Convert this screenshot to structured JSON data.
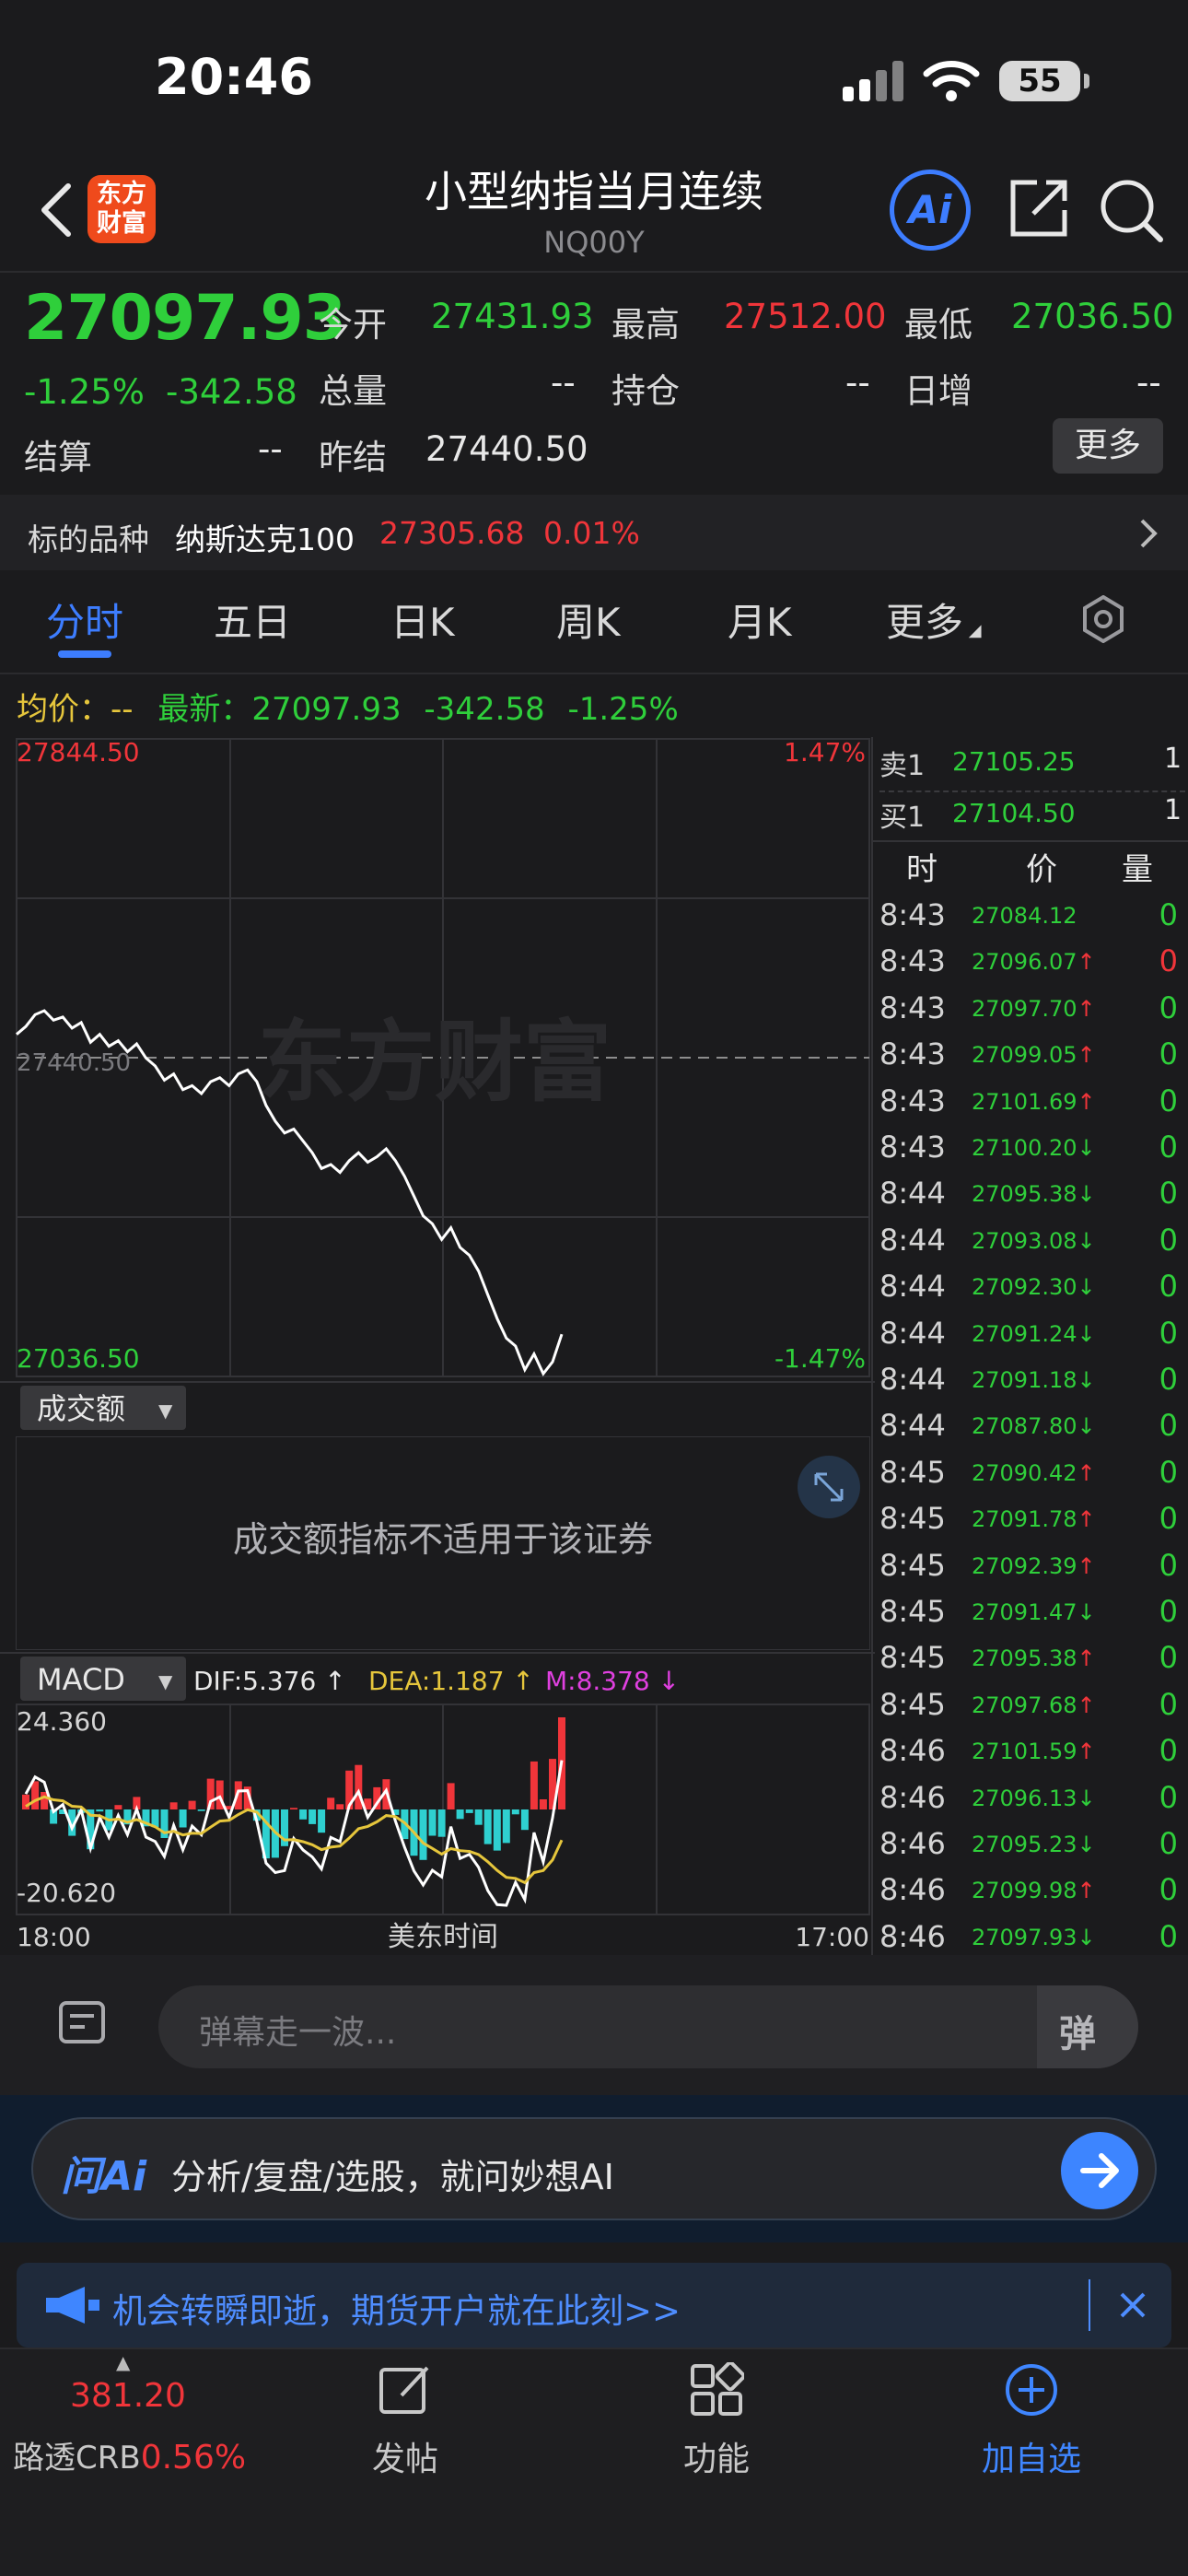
{
  "status_bar": {
    "time": "20:46",
    "battery": "55"
  },
  "header": {
    "logo_text_line1": "东方",
    "logo_text_line2": "财富",
    "title": "小型纳指当月连续",
    "subtitle": "NQ00Y",
    "ai_label": "Ai"
  },
  "quote": {
    "price": "27097.93",
    "change_pct": "-1.25%",
    "change": "-342.58",
    "open_label": "今开",
    "open": "27431.93",
    "high_label": "最高",
    "high": "27512.00",
    "low_label": "最低",
    "low": "27036.50",
    "volume_label": "总量",
    "volume": "--",
    "oi_label": "持仓",
    "oi": "--",
    "daily_inc_label": "日增",
    "daily_inc": "--",
    "settle_label": "结算",
    "settle": "--",
    "prev_settle_label": "昨结",
    "prev_settle": "27440.50",
    "more_label": "更多"
  },
  "underlying": {
    "label": "标的品种",
    "name": "纳斯达克100",
    "price": "27305.68",
    "pct": "0.01%"
  },
  "tabs": [
    {
      "label": "分时",
      "active": true
    },
    {
      "label": "五日"
    },
    {
      "label": "日K"
    },
    {
      "label": "周K"
    },
    {
      "label": "月K"
    },
    {
      "label": "更多"
    }
  ],
  "info_line": {
    "avg_label": "均价：",
    "avg_value": "--",
    "latest_label": "最新：",
    "latest_value": "27097.93",
    "latest_change": "-342.58",
    "latest_pct": "-1.25%"
  },
  "chart": {
    "price_high": "27844.50",
    "price_low": "27036.50",
    "pct_high": "1.47%",
    "pct_low": "-1.47%",
    "ref_label": "27440.50",
    "watermark": "东方财富",
    "volume_indicator": "成交额",
    "volume_message": "成交额指标不适用于该证券",
    "macd_indicator": "MACD",
    "dif": "DIF:5.376 ↑",
    "dea": "DEA:1.187 ↑",
    "m": "M:8.378 ↓",
    "macd_high": "24.360",
    "macd_low": "-20.620",
    "time_start": "18:00",
    "time_mid": "美东时间",
    "time_end": "17:00"
  },
  "chart_data": {
    "type": "line",
    "y_range": [
      27036.5,
      27844.5
    ],
    "reference": 27440.5,
    "x_range": [
      "18:00",
      "17:00"
    ],
    "trace": [
      27470,
      27480,
      27495,
      27500,
      27488,
      27492,
      27478,
      27485,
      27460,
      27470,
      27455,
      27462,
      27448,
      27458,
      27440,
      27430,
      27412,
      27420,
      27400,
      27405,
      27395,
      27410,
      27415,
      27405,
      27420,
      27425,
      27410,
      27380,
      27360,
      27345,
      27350,
      27335,
      27320,
      27300,
      27305,
      27295,
      27310,
      27320,
      27308,
      27315,
      27325,
      27310,
      27290,
      27265,
      27240,
      27230,
      27210,
      27225,
      27200,
      27190,
      27170,
      27140,
      27110,
      27085,
      27075,
      27045,
      27065,
      27040,
      27055,
      27090
    ],
    "macd": {
      "y_range": [
        -20.62,
        24.36
      ],
      "dif": 5.376,
      "dea": 1.187,
      "m": 8.378
    }
  },
  "order_book": {
    "sell_label": "卖1",
    "sell_price": "27105.25",
    "sell_vol": "1",
    "buy_label": "买1",
    "buy_price": "27104.50",
    "buy_vol": "1",
    "col_time": "时",
    "col_price": "价",
    "col_vol": "量"
  },
  "ticks": [
    {
      "time": "8:43",
      "price": "27084.12",
      "arrow": "",
      "vol": "0",
      "color": "g",
      "vcolor": "g"
    },
    {
      "time": "8:43",
      "price": "27096.07",
      "arrow": "↑",
      "vol": "0",
      "color": "g",
      "vcolor": "r"
    },
    {
      "time": "8:43",
      "price": "27097.70",
      "arrow": "↑",
      "vol": "0",
      "color": "g",
      "vcolor": "g"
    },
    {
      "time": "8:43",
      "price": "27099.05",
      "arrow": "↑",
      "vol": "0",
      "color": "g",
      "vcolor": "g"
    },
    {
      "time": "8:43",
      "price": "27101.69",
      "arrow": "↑",
      "vol": "0",
      "color": "g",
      "vcolor": "g"
    },
    {
      "time": "8:43",
      "price": "27100.20",
      "arrow": "↓",
      "vol": "0",
      "color": "g",
      "vcolor": "g"
    },
    {
      "time": "8:44",
      "price": "27095.38",
      "arrow": "↓",
      "vol": "0",
      "color": "g",
      "vcolor": "g"
    },
    {
      "time": "8:44",
      "price": "27093.08",
      "arrow": "↓",
      "vol": "0",
      "color": "g",
      "vcolor": "g"
    },
    {
      "time": "8:44",
      "price": "27092.30",
      "arrow": "↓",
      "vol": "0",
      "color": "g",
      "vcolor": "g"
    },
    {
      "time": "8:44",
      "price": "27091.24",
      "arrow": "↓",
      "vol": "0",
      "color": "g",
      "vcolor": "g"
    },
    {
      "time": "8:44",
      "price": "27091.18",
      "arrow": "↓",
      "vol": "0",
      "color": "g",
      "vcolor": "g"
    },
    {
      "time": "8:44",
      "price": "27087.80",
      "arrow": "↓",
      "vol": "0",
      "color": "g",
      "vcolor": "g"
    },
    {
      "time": "8:45",
      "price": "27090.42",
      "arrow": "↑",
      "vol": "0",
      "color": "g",
      "vcolor": "g"
    },
    {
      "time": "8:45",
      "price": "27091.78",
      "arrow": "↑",
      "vol": "0",
      "color": "g",
      "vcolor": "g"
    },
    {
      "time": "8:45",
      "price": "27092.39",
      "arrow": "↑",
      "vol": "0",
      "color": "g",
      "vcolor": "g"
    },
    {
      "time": "8:45",
      "price": "27091.47",
      "arrow": "↓",
      "vol": "0",
      "color": "g",
      "vcolor": "g"
    },
    {
      "time": "8:45",
      "price": "27095.38",
      "arrow": "↑",
      "vol": "0",
      "color": "g",
      "vcolor": "g"
    },
    {
      "time": "8:45",
      "price": "27097.68",
      "arrow": "↑",
      "vol": "0",
      "color": "g",
      "vcolor": "g"
    },
    {
      "time": "8:46",
      "price": "27101.59",
      "arrow": "↑",
      "vol": "0",
      "color": "g",
      "vcolor": "g"
    },
    {
      "time": "8:46",
      "price": "27096.13",
      "arrow": "↓",
      "vol": "0",
      "color": "g",
      "vcolor": "g"
    },
    {
      "time": "8:46",
      "price": "27095.23",
      "arrow": "↓",
      "vol": "0",
      "color": "g",
      "vcolor": "g"
    },
    {
      "time": "8:46",
      "price": "27099.98",
      "arrow": "↑",
      "vol": "0",
      "color": "g",
      "vcolor": "g"
    },
    {
      "time": "8:46",
      "price": "27097.93",
      "arrow": "↓",
      "vol": "0",
      "color": "g",
      "vcolor": "g"
    }
  ],
  "barrage": {
    "placeholder": "弹幕走一波...",
    "toggle_label": "弹"
  },
  "ai_bar": {
    "logo": "问Ai",
    "text": "分析/复盘/选股，就问妙想AI"
  },
  "notice": {
    "text": "机会转瞬即逝，期货开户就在此刻>>"
  },
  "bottom_nav": {
    "index_value": "381.20",
    "index_name": "路透CRB",
    "index_pct": "0.56%",
    "post_label": "发帖",
    "func_label": "功能",
    "add_label": "加自选"
  }
}
